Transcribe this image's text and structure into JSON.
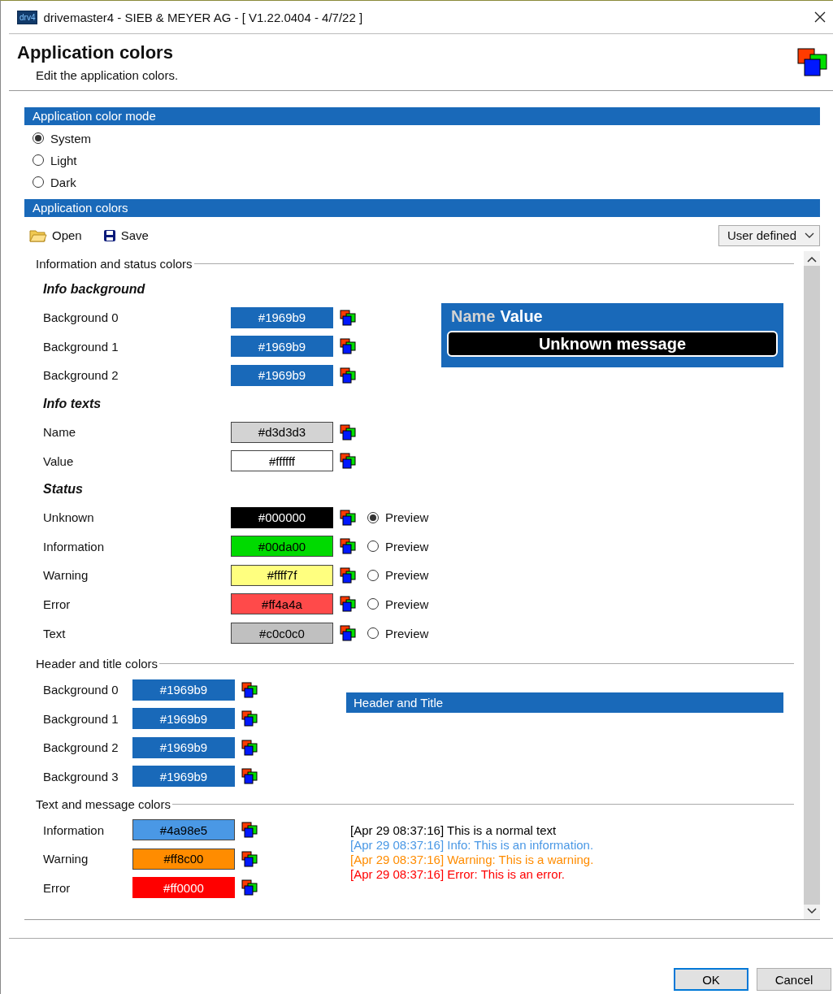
{
  "window": {
    "app_icon_text": "drv4",
    "title": "drivemaster4 - SIEB & MEYER AG - [ V1.22.0404 - 4/7/22 ]"
  },
  "header": {
    "title": "Application colors",
    "subtitle": "Edit the application colors."
  },
  "color_mode": {
    "heading": "Application color mode",
    "options": [
      {
        "label": "System",
        "selected": true
      },
      {
        "label": "Light",
        "selected": false
      },
      {
        "label": "Dark",
        "selected": false
      }
    ]
  },
  "app_colors": {
    "heading": "Application colors",
    "toolbar": {
      "open": "Open",
      "save": "Save",
      "preset": "User defined"
    },
    "groups": [
      {
        "kind": "info",
        "title": "Information and status colors",
        "preview": {
          "name": "Name",
          "value": "Value",
          "message": "Unknown message"
        },
        "subgroups": [
          {
            "title": "Info background",
            "rows": [
              {
                "label": "Background 0",
                "value": "#1969b9",
                "color": "#1969b9"
              },
              {
                "label": "Background 1",
                "value": "#1969b9",
                "color": "#1969b9"
              },
              {
                "label": "Background 2",
                "value": "#1969b9",
                "color": "#1969b9"
              }
            ]
          },
          {
            "title": "Info texts",
            "rows": [
              {
                "label": "Name",
                "value": "#d3d3d3",
                "color": "#d3d3d3"
              },
              {
                "label": "Value",
                "value": "#ffffff",
                "color": "#ffffff"
              }
            ]
          },
          {
            "title": "Status",
            "rows": [
              {
                "label": "Unknown",
                "value": "#000000",
                "color": "#000000",
                "preview": {
                  "label": "Preview",
                  "selected": true
                }
              },
              {
                "label": "Information",
                "value": "#00da00",
                "color": "#00da00",
                "preview": {
                  "label": "Preview",
                  "selected": false
                }
              },
              {
                "label": "Warning",
                "value": "#ffff7f",
                "color": "#ffff7f",
                "preview": {
                  "label": "Preview",
                  "selected": false
                }
              },
              {
                "label": "Error",
                "value": "#ff4a4a",
                "color": "#ff4a4a",
                "preview": {
                  "label": "Preview",
                  "selected": false
                }
              },
              {
                "label": "Text",
                "value": "#c0c0c0",
                "color": "#c0c0c0",
                "preview": {
                  "label": "Preview",
                  "selected": false
                }
              }
            ]
          }
        ]
      },
      {
        "kind": "header",
        "title": "Header and title colors",
        "preview": {
          "text": "Header and Title"
        },
        "subgroups": [
          {
            "rows": [
              {
                "label": "Background 0",
                "value": "#1969b9",
                "color": "#1969b9"
              },
              {
                "label": "Background 1",
                "value": "#1969b9",
                "color": "#1969b9"
              },
              {
                "label": "Background 2",
                "value": "#1969b9",
                "color": "#1969b9"
              },
              {
                "label": "Background 3",
                "value": "#1969b9",
                "color": "#1969b9"
              }
            ]
          }
        ]
      },
      {
        "kind": "text",
        "title": "Text and message colors",
        "preview": {
          "lines": [
            {
              "kind": "normal",
              "text": "[Apr 29 08:37:16] This is a normal text"
            },
            {
              "kind": "information",
              "text": "[Apr 29 08:37:16] Info: This is an information."
            },
            {
              "kind": "warning",
              "text": "[Apr 29 08:37:16] Warning: This is a warning."
            },
            {
              "kind": "error",
              "text": "[Apr 29 08:37:16] Error: This is an error."
            }
          ]
        },
        "subgroups": [
          {
            "rows": [
              {
                "label": "Information",
                "value": "#4a98e5",
                "color": "#4a98e5"
              },
              {
                "label": "Warning",
                "value": "#ff8c00",
                "color": "#ff8c00"
              },
              {
                "label": "Error",
                "value": "#ff0000",
                "color": "#ff0000"
              }
            ]
          }
        ]
      }
    ]
  },
  "buttons": [
    {
      "label": "OK",
      "selected": true
    },
    {
      "label": "Cancel",
      "selected": false
    }
  ]
}
